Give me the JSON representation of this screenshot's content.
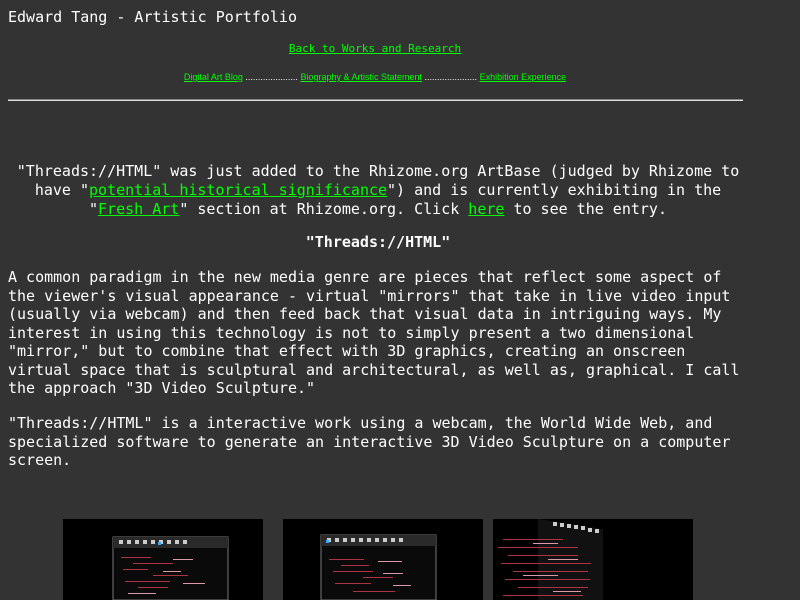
{
  "header": {
    "title": "Edward Tang - Artistic Portfolio",
    "back_link": "Back to Works and Research"
  },
  "nav": {
    "items": [
      "Digital Art Blog",
      "Biography & Artistic Statement",
      "Exhibition Experience"
    ],
    "separator": "....................."
  },
  "intro": {
    "part1": "\"Threads://HTML\" was just added to the Rhizome.org ArtBase (judged by Rhizome to have \"",
    "link1": "potential historical significance",
    "part2": "\") and is currently exhibiting in the \"",
    "link2": "Fresh Art",
    "part3": "\" section at Rhizome.org. Click ",
    "link3": "here",
    "part4": " to see the entry."
  },
  "work": {
    "title": "\"Threads://HTML\"",
    "paragraph1": "A common paradigm in the new media genre are pieces that reflect some aspect of the viewer's visual appearance - virtual \"mirrors\" that take in live video input (usually via webcam) and then feed back that visual data in intriguing ways. My interest in using this technology is not to simply present a two dimensional \"mirror,\" but to combine that effect with 3D graphics, creating an onscreen virtual space that is sculptural and architectural, as well as, graphical. I call the approach \"3D Video Sculpture.\"",
    "paragraph2": "\"Threads://HTML\" is a interactive work using a webcam, the World Wide Web, and specialized software to generate an interactive 3D Video Sculpture on a computer screen."
  },
  "colors": {
    "background": "#333333",
    "link": "#00ff00",
    "text": "#ffffff"
  }
}
